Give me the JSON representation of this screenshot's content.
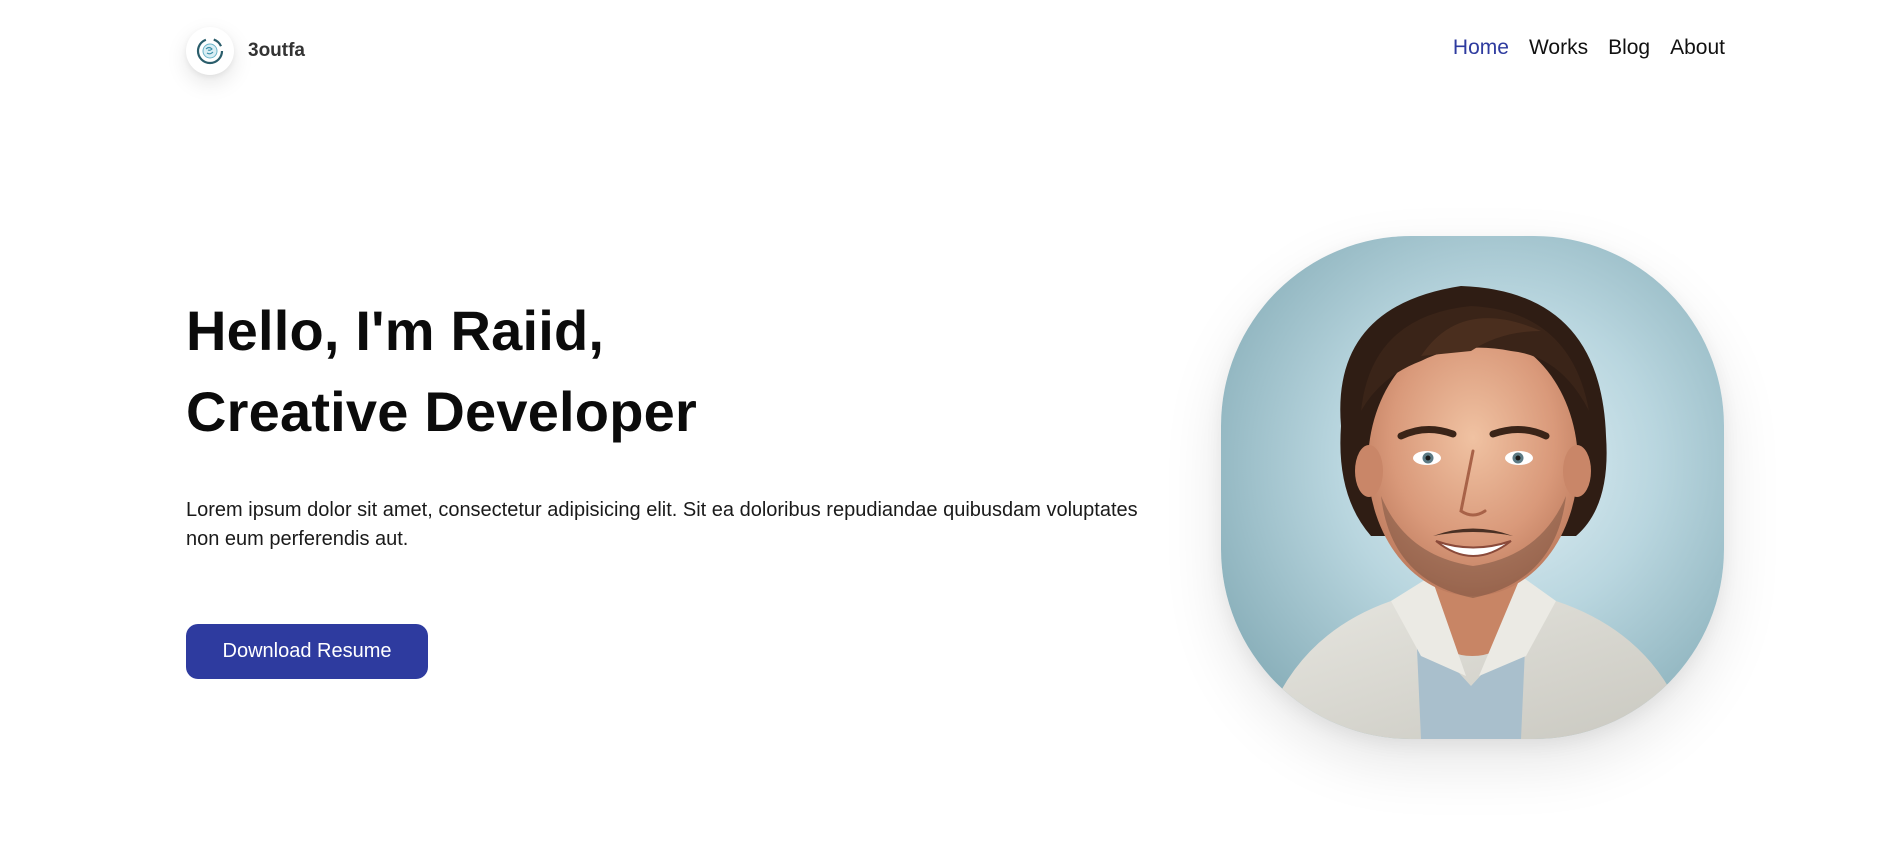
{
  "brand": {
    "name": "3outfa"
  },
  "nav": {
    "items": [
      {
        "label": "Home",
        "active": true
      },
      {
        "label": "Works",
        "active": false
      },
      {
        "label": "Blog",
        "active": false
      },
      {
        "label": "About",
        "active": false
      }
    ]
  },
  "hero": {
    "heading_line1": "Hello, I'm Raiid,",
    "heading_line2": "Creative Developer",
    "description": "Lorem ipsum dolor sit amet, consectetur adipisicing elit. Sit ea doloribus repudiandae quibusdam voluptates non eum perferendis aut.",
    "cta_label": "Download Resume"
  },
  "colors": {
    "accent": "#2e3b9f",
    "text": "#111111",
    "background": "#ffffff"
  },
  "icons": {
    "logo": "brand-logo-icon"
  }
}
